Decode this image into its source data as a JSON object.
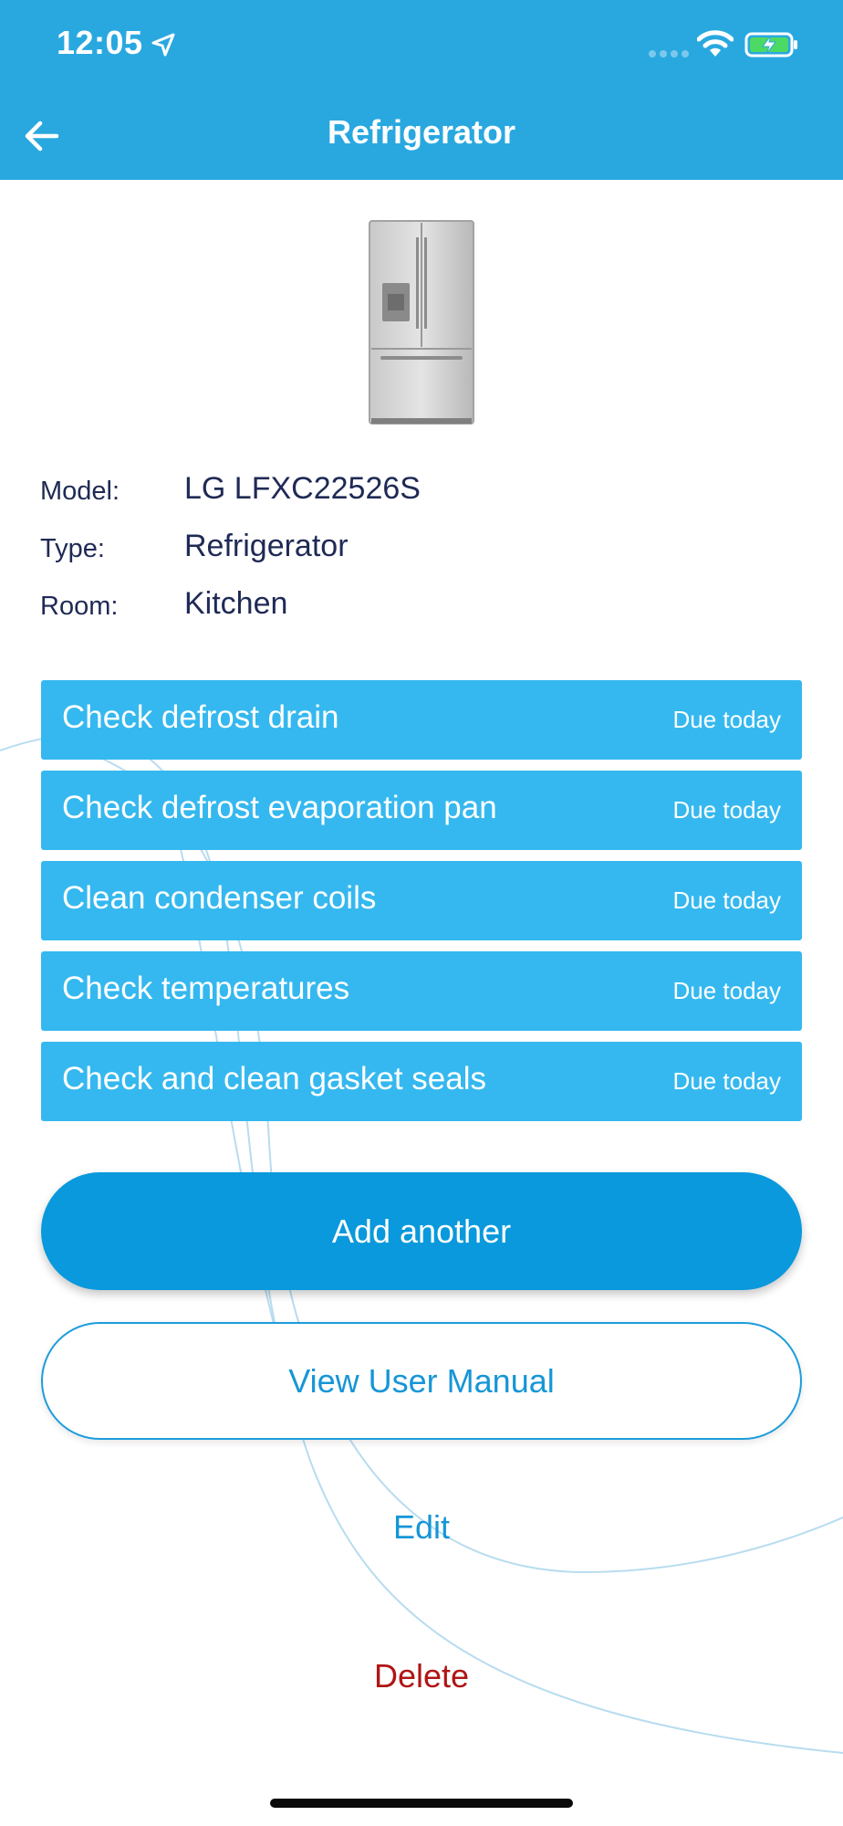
{
  "status_bar": {
    "time": "12:05",
    "location_icon": "location-arrow-icon",
    "signal_icon": "cellular-signal-icon",
    "wifi_icon": "wifi-icon",
    "battery_icon": "battery-charging-icon"
  },
  "header": {
    "title": "Refrigerator",
    "back_icon": "arrow-left-icon",
    "background_color": "#29a8e0"
  },
  "appliance": {
    "image_icon": "refrigerator-image",
    "model_label": "Model:",
    "model_value": "LG LFXC22526S",
    "type_label": "Type:",
    "type_value": "Refrigerator",
    "room_label": "Room:",
    "room_value": "Kitchen"
  },
  "tasks": [
    {
      "name": "Check defrost drain",
      "due": "Due today"
    },
    {
      "name": "Check defrost evaporation pan",
      "due": "Due today"
    },
    {
      "name": "Clean condenser coils",
      "due": "Due today"
    },
    {
      "name": "Check temperatures",
      "due": "Due today"
    },
    {
      "name": "Check and clean gasket seals",
      "due": "Due today"
    }
  ],
  "actions": {
    "add_another": "Add another",
    "view_manual": "View User Manual",
    "edit": "Edit",
    "delete": "Delete"
  },
  "colors": {
    "task_bg": "#35b8ef",
    "primary_button": "#0999dc",
    "link": "#1696d6",
    "delete": "#b01515",
    "text_dark": "#1f2a55"
  }
}
